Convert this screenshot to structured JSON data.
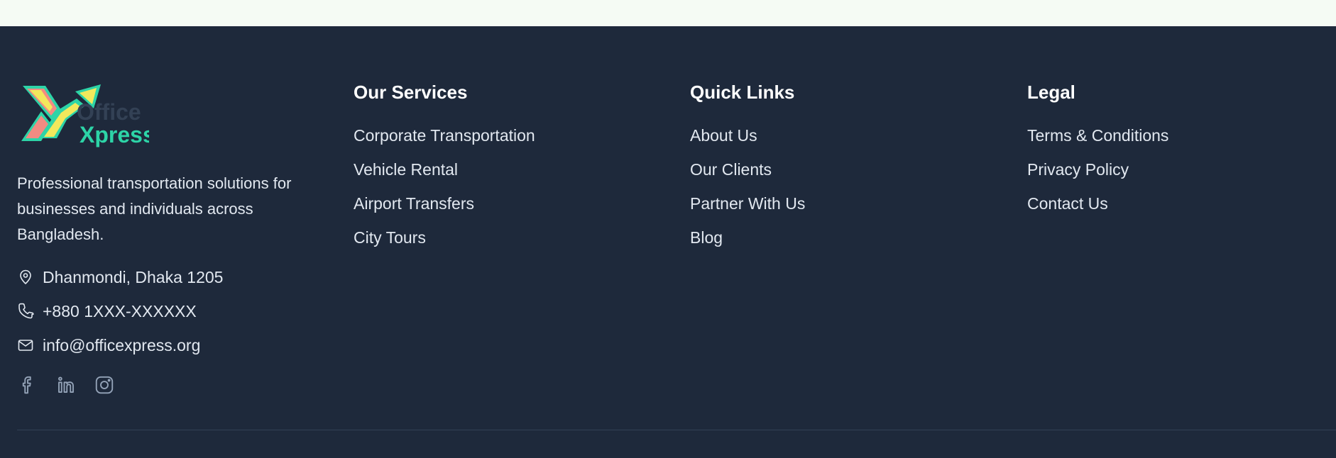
{
  "brand": {
    "logo_line1": "Office",
    "logo_line2": "Xpress",
    "tagline": "Professional transportation solutions for businesses and individuals across Bangladesh.",
    "colors": {
      "green": "#2dd4a7",
      "yellow": "#f2e85c",
      "pink": "#f28b82",
      "dark": "#334155"
    }
  },
  "contact": {
    "address": "Dhanmondi, Dhaka 1205",
    "phone": "+880 1XXX-XXXXXX",
    "email": "info@officexpress.org"
  },
  "socials": [
    "facebook-icon",
    "linkedin-icon",
    "instagram-icon"
  ],
  "services": {
    "title": "Our Services",
    "links": [
      "Corporate Transportation",
      "Vehicle Rental",
      "Airport Transfers",
      "City Tours"
    ]
  },
  "quick_links": {
    "title": "Quick Links",
    "links": [
      "About Us",
      "Our Clients",
      "Partner With Us",
      "Blog"
    ]
  },
  "legal": {
    "title": "Legal",
    "links": [
      "Terms & Conditions",
      "Privacy Policy",
      "Contact Us"
    ]
  }
}
